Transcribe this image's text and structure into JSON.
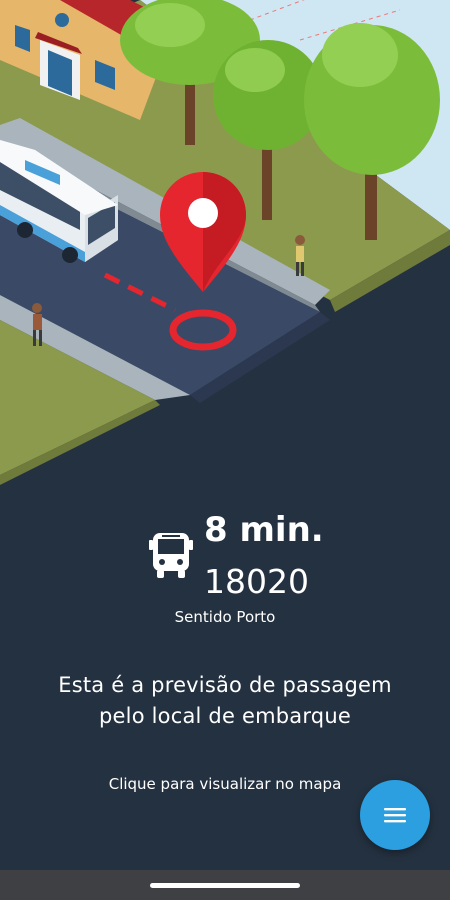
{
  "arrival": {
    "minutes": "8 min.",
    "line_number": "18020",
    "direction": "Sentido Porto"
  },
  "info": {
    "line1": "Esta é a previsão de passagem",
    "line2": "pelo local de embarque"
  },
  "map_link": "Clique para visualizar no mapa",
  "icons": {
    "bus": "bus-icon",
    "menu": "menu-icon",
    "pin": "map-pin-icon"
  },
  "colors": {
    "background": "#243140",
    "accent": "#2b9fe0",
    "pin": "#e5262e",
    "text": "#ffffff"
  }
}
